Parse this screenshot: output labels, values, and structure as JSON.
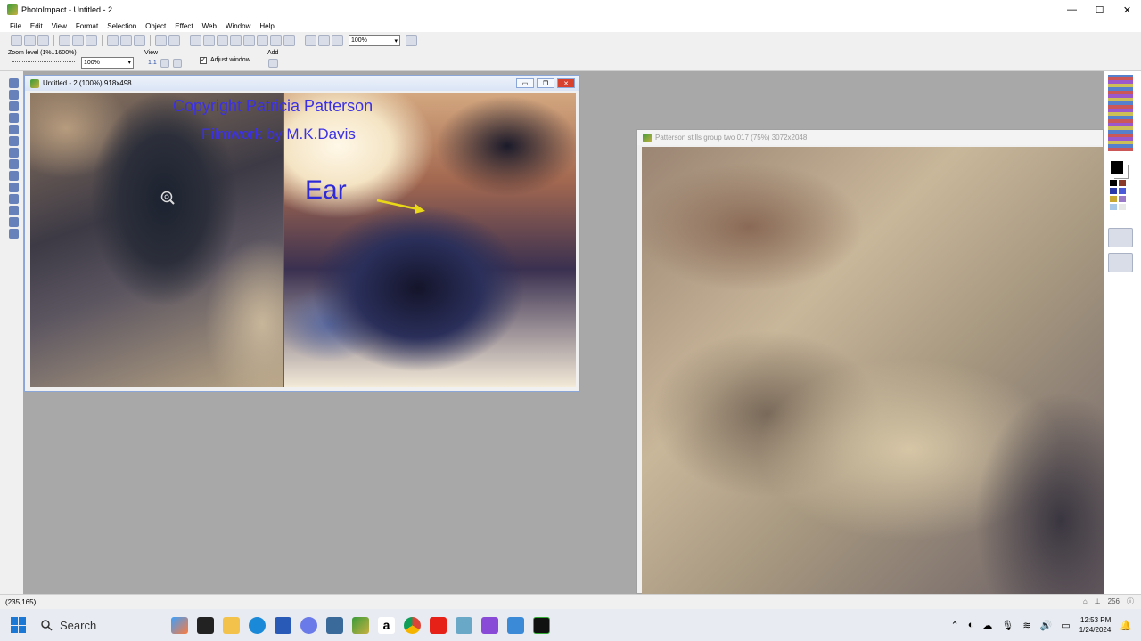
{
  "window": {
    "title": "PhotoImpact - Untitled - 2"
  },
  "window_controls": {
    "minimize": "—",
    "maximize": "☐",
    "close": "✕"
  },
  "menu": [
    "File",
    "Edit",
    "View",
    "Format",
    "Selection",
    "Object",
    "Effect",
    "Web",
    "Window",
    "Help"
  ],
  "toolbar": {
    "zoom_value": "100%"
  },
  "attribute_bar": {
    "zoom_label": "Zoom level (1%..1600%)",
    "zoom_value": "100%",
    "view_label": "View",
    "view_ratio": "1:1",
    "adjust_window_label": "Adjust window",
    "adjust_window_checked": true,
    "add_label": "Add"
  },
  "doc1": {
    "title": "Untitled - 2 (100%) 918x498",
    "copyright_text": "Copyright Patricia Patterson",
    "filmwork_text": "Filmwork by M.K.Davis",
    "ear_label": "Ear",
    "annotation_color": "#3b30e6",
    "arrow_color": "#e8d818"
  },
  "doc2": {
    "title": "Patterson stills group two 017 (75%) 3072x2048"
  },
  "status": {
    "coords": "(235,165)",
    "zoom_readout": "256"
  },
  "taskbar": {
    "search_placeholder": "Search",
    "time": "12:53 PM",
    "date": "1/24/2024"
  },
  "icons": [
    "app-icon",
    "search-icon",
    "magnifier-cursor-icon",
    "arrow-icon"
  ]
}
